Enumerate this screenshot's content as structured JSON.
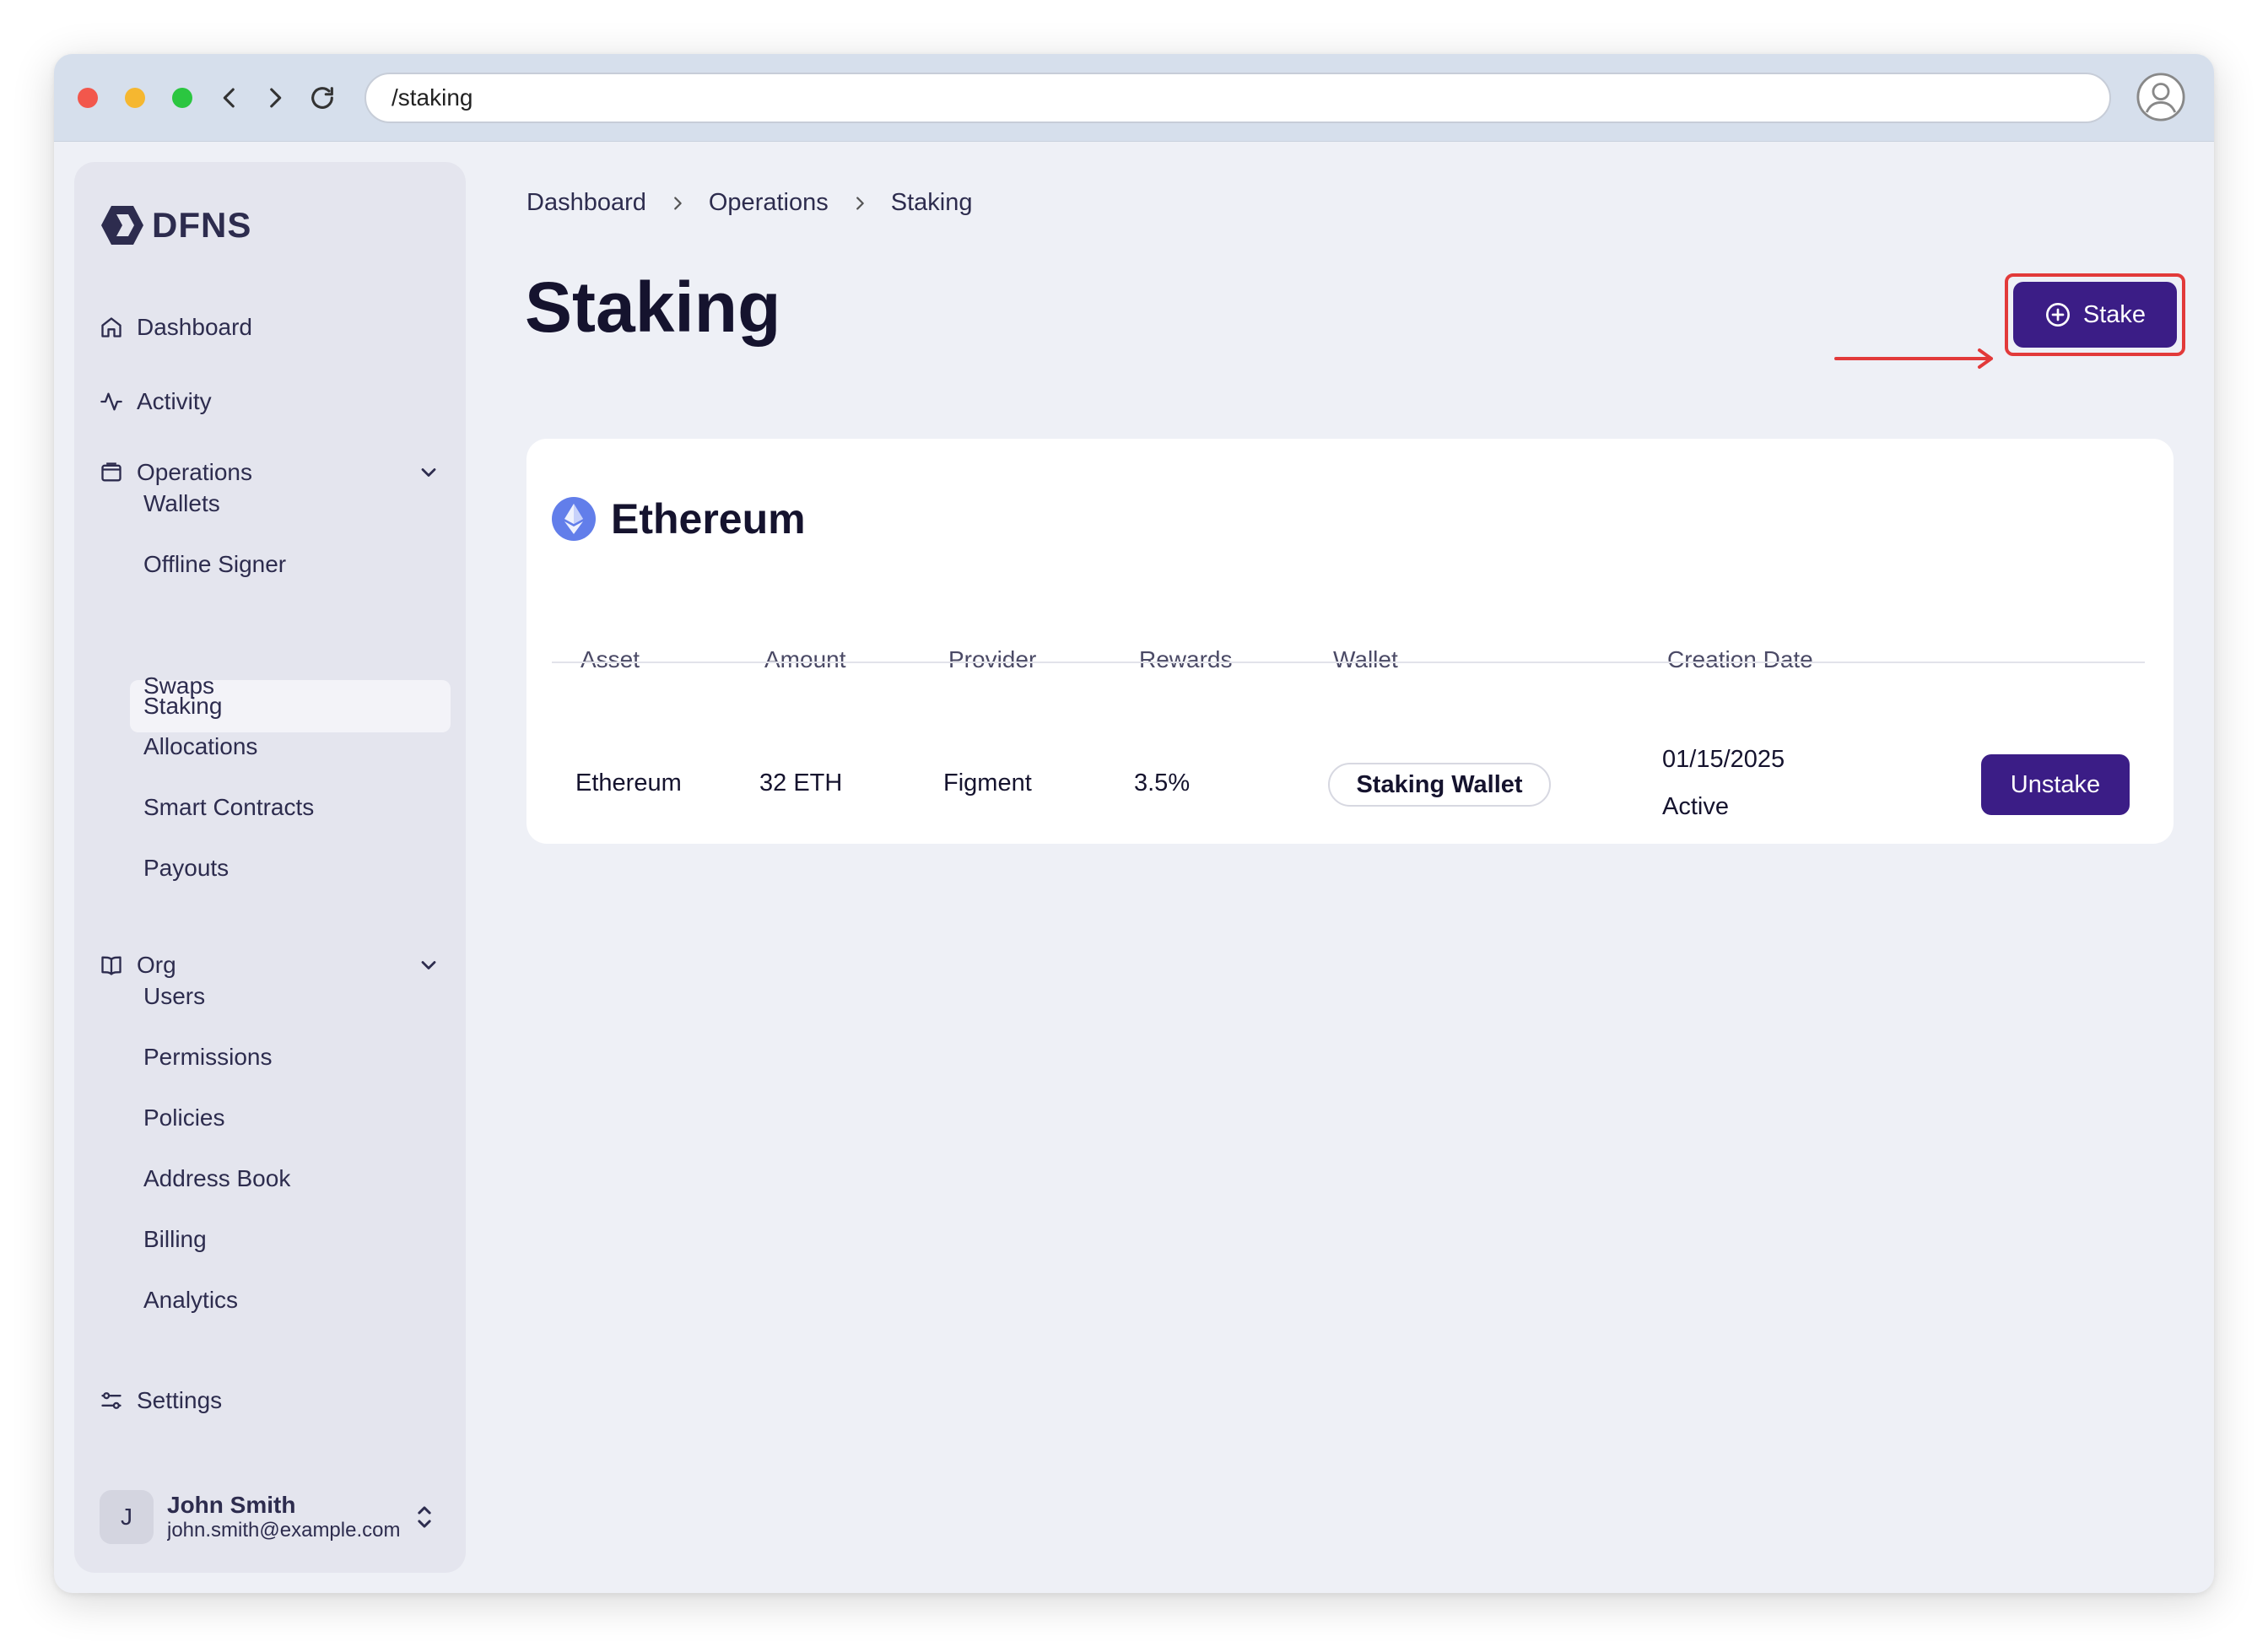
{
  "browser": {
    "url": "/staking"
  },
  "sidebar": {
    "logo_text": "DFNS",
    "dashboard_label": "Dashboard",
    "activity_label": "Activity",
    "operations_label": "Operations",
    "operations_items": [
      "Wallets",
      "Offline Signer",
      "Staking",
      "Swaps",
      "Allocations",
      "Smart Contracts",
      "Payouts"
    ],
    "org_label": "Org",
    "org_items": [
      "Users",
      "Permissions",
      "Policies",
      "Address Book",
      "Billing",
      "Analytics"
    ],
    "settings_label": "Settings",
    "user": {
      "initial": "J",
      "name": "John Smith",
      "email": "john.smith@example.com"
    }
  },
  "breadcrumb": [
    "Dashboard",
    "Operations",
    "Staking"
  ],
  "page_title": "Staking",
  "stake_button_label": "Stake",
  "card": {
    "title": "Ethereum",
    "columns": [
      "Asset",
      "Amount",
      "Provider",
      "Rewards",
      "Wallet",
      "Creation Date"
    ],
    "row": {
      "asset": "Ethereum",
      "amount": "32 ETH",
      "provider": "Figment",
      "rewards": "3.5%",
      "wallet": "Staking Wallet",
      "creation_date": "01/15/2025",
      "status": "Active",
      "action_label": "Unstake"
    }
  },
  "colors": {
    "primary": "#3b1d86",
    "annotation": "#e23a3a",
    "ethereum": "#627eea"
  }
}
